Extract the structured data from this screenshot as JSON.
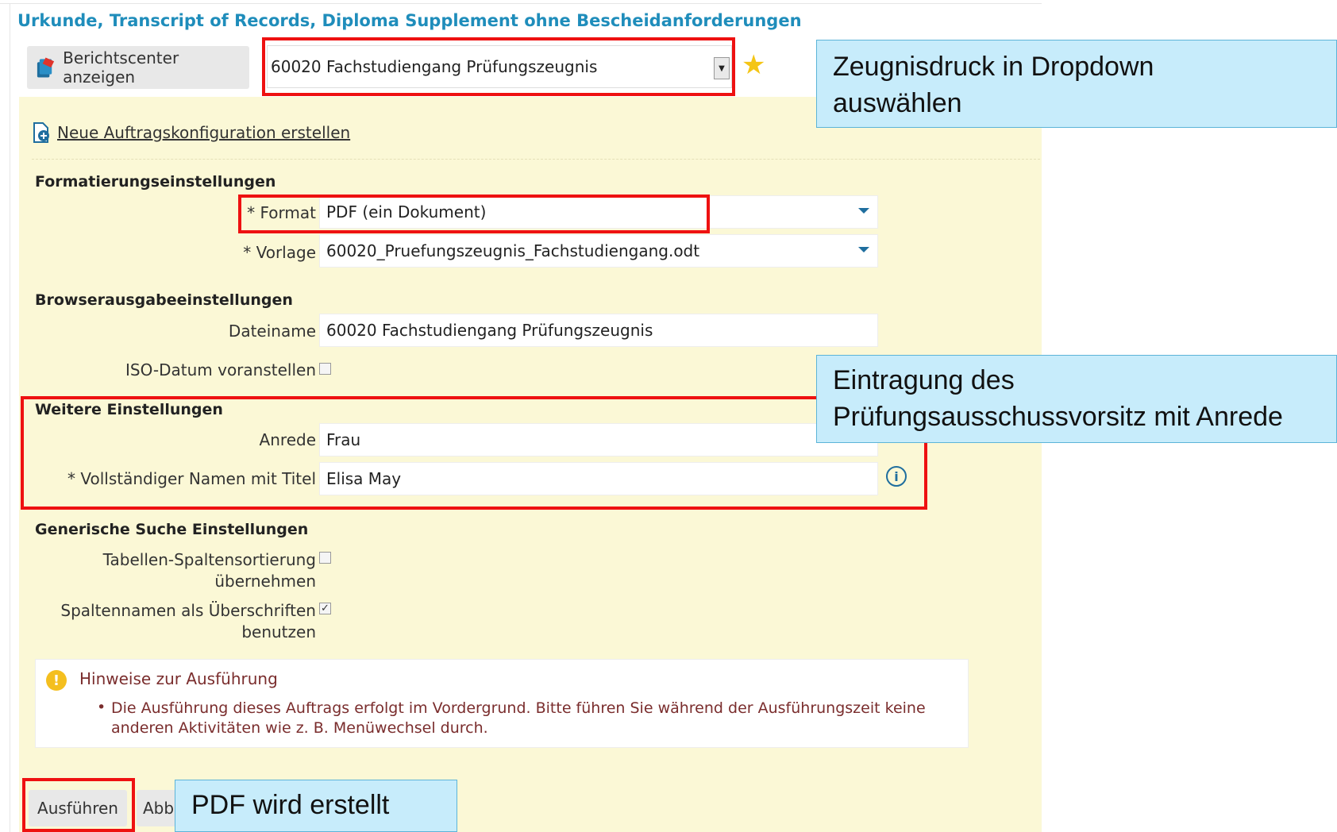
{
  "page": {
    "title": "Urkunde, Transcript of Records, Diploma Supplement ohne Bescheidanforderungen"
  },
  "toolbar": {
    "report_center_label": "Berichtscenter anzeigen",
    "report_select_value": "60020 Fachstudiengang Prüfungszeugnis",
    "new_config_label": "Neue Auftragskonfiguration erstellen"
  },
  "sections": {
    "format_settings": {
      "title": "Formatierungseinstellungen",
      "format_label": "* Format",
      "format_value": "PDF (ein Dokument)",
      "template_label": "* Vorlage",
      "template_value": "60020_Pruefungszeugnis_Fachstudiengang.odt"
    },
    "browser_output": {
      "title": "Browserausgabeeinstellungen",
      "filename_label": "Dateiname",
      "filename_value": "60020 Fachstudiengang Prüfungszeugnis",
      "iso_date_label": "ISO-Datum voranstellen",
      "iso_date_checked": false
    },
    "further": {
      "title": "Weitere Einstellungen",
      "salutation_label": "Anrede",
      "salutation_value": "Frau",
      "fullname_label": "* Vollständiger Namen mit Titel",
      "fullname_value": "Elisa May"
    },
    "generic_search": {
      "title": "Generische Suche Einstellungen",
      "sort_label_1": "Tabellen-Spaltensortierung",
      "sort_label_2": "übernehmen",
      "sort_checked": false,
      "headers_label_1": "Spaltennamen als Überschriften",
      "headers_label_2": "benutzen",
      "headers_checked": true
    }
  },
  "hint": {
    "title": "Hinweise zur Ausführung",
    "text": "Die Ausführung dieses Auftrags erfolgt im Vordergrund. Bitte führen Sie während der Ausführungszeit keine anderen Aktivitäten wie z. B. Menüwechsel durch."
  },
  "actions": {
    "execute_label": "Ausführen",
    "cancel_label": "Abb"
  },
  "callouts": {
    "dropdown_1": "Zeugnisdruck in Dropdown",
    "dropdown_2": "auswählen",
    "chair_1": "Eintragung des",
    "chair_2": "Prüfungsausschussvorsitz mit Anrede",
    "pdf": "PDF wird erstellt"
  },
  "colors": {
    "title_blue": "#1f8dbb",
    "panel_yellow": "#fbf8d6",
    "highlight_red": "#ee1111",
    "callout_blue": "#c7ecfb",
    "star_yellow": "#f4c515"
  },
  "icons": {
    "report_center": "report-book-icon",
    "new_config": "document-add-icon",
    "favorite": "star-icon",
    "info": "info-icon",
    "hint": "warning-info-icon"
  }
}
